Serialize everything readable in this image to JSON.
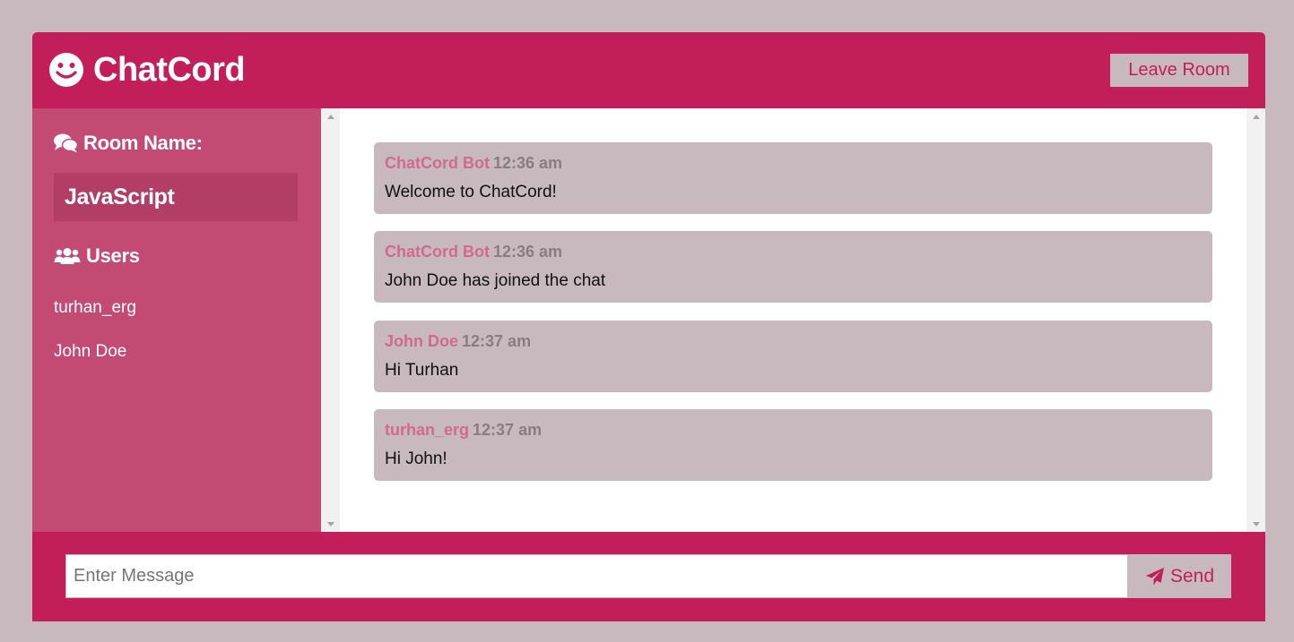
{
  "colors": {
    "page_background": "#c8b9be",
    "brand": "#c21f5a",
    "sidebar": "#c34a72",
    "room_box": "#b23e66",
    "message_bg": "#c8b9be",
    "author": "#d06a8f",
    "time": "#8a7c82"
  },
  "header": {
    "logo_icon": "smile-icon",
    "app_title": "ChatCord",
    "leave_label": "Leave Room"
  },
  "sidebar": {
    "room_icon": "comments-icon",
    "room_heading": "Room Name:",
    "room_name": "JavaScript",
    "users_icon": "users-icon",
    "users_heading": "Users",
    "users": [
      "turhan_erg",
      "John Doe"
    ]
  },
  "messages": [
    {
      "author": "ChatCord Bot",
      "time": "12:36 am",
      "text": "Welcome to ChatCord!"
    },
    {
      "author": "ChatCord Bot",
      "time": "12:36 am",
      "text": "John Doe has joined the chat"
    },
    {
      "author": "John Doe",
      "time": "12:37 am",
      "text": "Hi Turhan"
    },
    {
      "author": "turhan_erg",
      "time": "12:37 am",
      "text": "Hi John!"
    }
  ],
  "form": {
    "placeholder": "Enter Message",
    "value": "",
    "send_icon": "paper-plane-icon",
    "send_label": "Send"
  }
}
